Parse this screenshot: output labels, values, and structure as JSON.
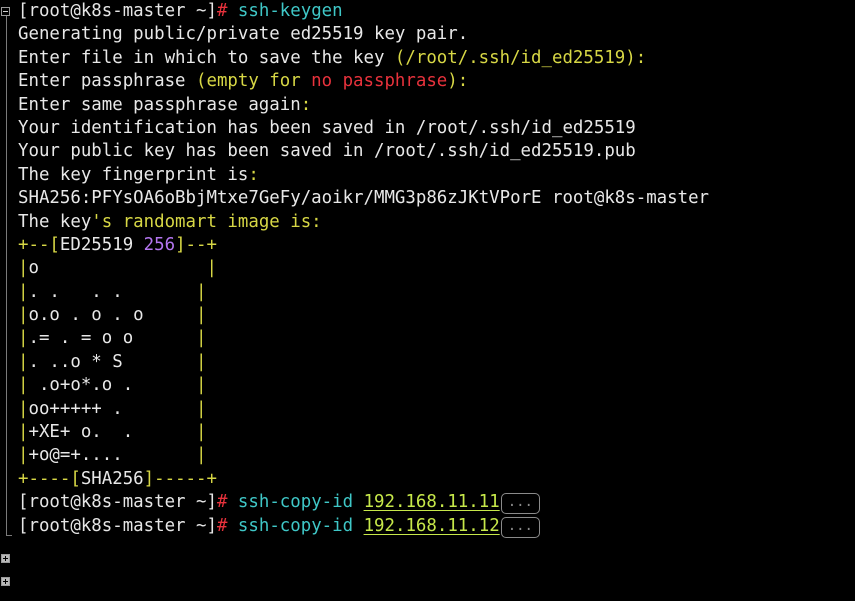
{
  "prompt": "[root@k8s-master ~]",
  "prompt_hash": "#",
  "cmd1": "ssh-keygen",
  "l2": "Generating public/private ed25519 key pair.",
  "l3a": "Enter file in which to save the key ",
  "l3b": "(/root/.ssh/id_ed25519):",
  "l4a": "Enter passphrase ",
  "l4b": "(empty for ",
  "l4c": "no passphrase",
  "l4d": "):",
  "l5a": "Enter same passphrase again",
  "l5b": ":",
  "l6": "Your identification has been saved in /root/.ssh/id_ed25519",
  "l7": "Your public key has been saved in /root/.ssh/id_ed25519.pub",
  "l8a": "The key fingerprint is",
  "l8b": ":",
  "l9a": "SHA256",
  "l9b": ":PFYsOA6oBbjMtxe7GeFy/aoikr/MMG3p86zJKtVPorE root@k8s-master",
  "l10a": "The key",
  "l10b": "'s randomart image is:",
  "art_top_a": "+--[",
  "art_top_b": "ED25519 ",
  "art_top_c": "256",
  "art_top_d": "]--+",
  "art": [
    {
      "p": "|",
      "t": "o",
      "s": "                |"
    },
    {
      "p": "|",
      "t": ". .   . .",
      "s": "       |"
    },
    {
      "p": "|",
      "t": "o.o . o . o",
      "s": "     |"
    },
    {
      "p": "|",
      "t": ".= . = o o",
      "s": "      |"
    },
    {
      "p": "|",
      "t": ". ..o * S",
      "s": "       |"
    },
    {
      "p": "|",
      "t": " .o+o*.o .",
      "s": "      |"
    },
    {
      "p": "|",
      "t": "oo+++++ .",
      "s": "       |"
    },
    {
      "p": "|",
      "t": "+XE+ o.  .",
      "s": "      |"
    },
    {
      "p": "|",
      "t": "+o@=+....",
      "s": "       |"
    }
  ],
  "art_bot_a": "+----[",
  "art_bot_b": "SHA256",
  "art_bot_c": "]-----+",
  "copy_cmd": "ssh-copy-id",
  "ip1": "192.168.11.11",
  "ip2": "192.168.11.12",
  "hint": "..."
}
